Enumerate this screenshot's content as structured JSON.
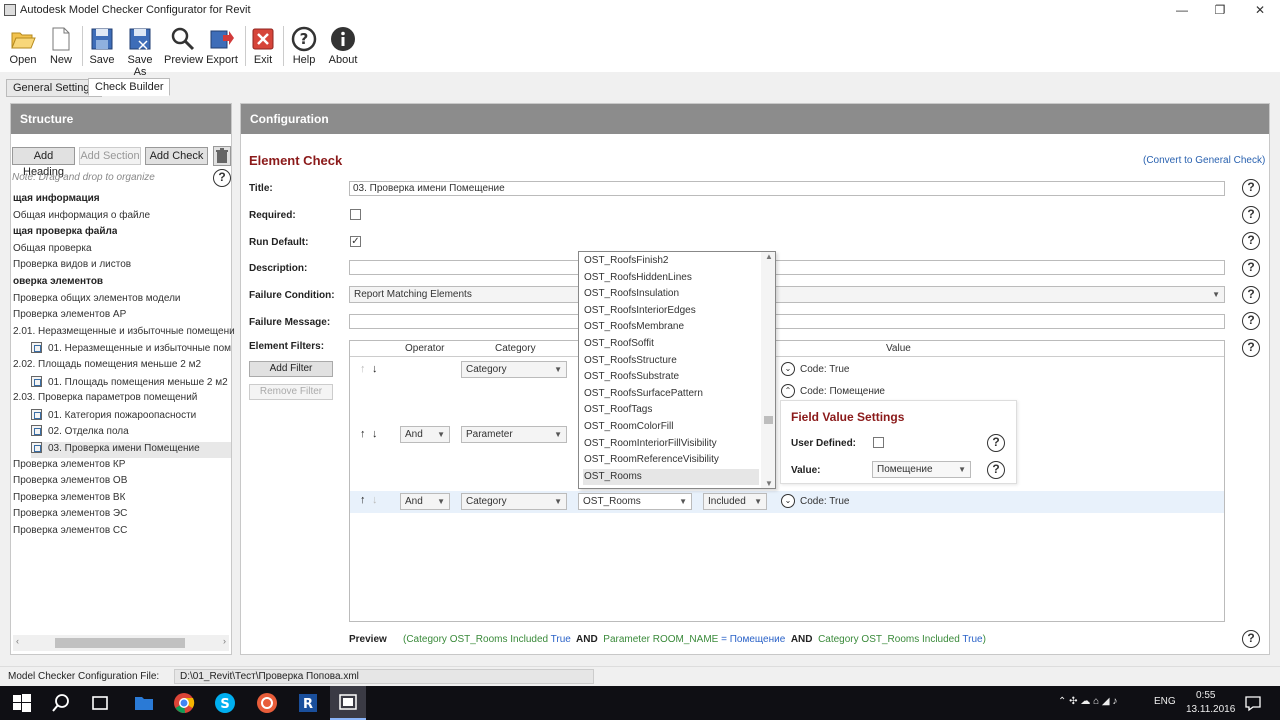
{
  "window": {
    "title": "Autodesk Model Checker Configurator for Revit",
    "minimize": "—",
    "maximize": "❐",
    "close": "✕"
  },
  "toolbar": {
    "open": "Open",
    "new": "New",
    "save": "Save",
    "save_as": "Save As",
    "preview": "Preview",
    "export": "Export",
    "exit": "Exit",
    "help": "Help",
    "about": "About"
  },
  "tabs": [
    "General Settings",
    "Check Builder"
  ],
  "structure": {
    "header": "Structure",
    "add_heading": "Add Heading",
    "add_section": "Add Section",
    "add_check": "Add Check",
    "note": "Note: Drag and drop to organize",
    "items": [
      {
        "label": "щая информация",
        "bold": true,
        "child": false
      },
      {
        "label": "Общая информация о файле",
        "bold": false,
        "child": false
      },
      {
        "label": "щая проверка файла",
        "bold": true,
        "child": false
      },
      {
        "label": "Общая проверка",
        "bold": false,
        "child": false
      },
      {
        "label": "Проверка видов и листов",
        "bold": false,
        "child": false
      },
      {
        "label": "оверка элементов",
        "bold": true,
        "child": false
      },
      {
        "label": "Проверка общих элементов модели",
        "bold": false,
        "child": false
      },
      {
        "label": "Проверка элементов АР",
        "bold": false,
        "child": false
      },
      {
        "label": "2.01. Неразмещенные и избыточные помещени",
        "bold": false,
        "child": false
      },
      {
        "label": "01. Неразмещенные и избыточные пом",
        "bold": false,
        "child": true
      },
      {
        "label": "2.02. Площадь помещения меньше 2 м2",
        "bold": false,
        "child": false
      },
      {
        "label": "01. Площадь помещения меньше 2 м2",
        "bold": false,
        "child": true
      },
      {
        "label": "2.03. Проверка параметров помещений",
        "bold": false,
        "child": false
      },
      {
        "label": "01. Категория пожароопасности",
        "bold": false,
        "child": true
      },
      {
        "label": "02. Отделка пола",
        "bold": false,
        "child": true
      },
      {
        "label": "03. Проверка имени Помещение",
        "bold": false,
        "child": true,
        "selected": true
      },
      {
        "label": "Проверка элементов КР",
        "bold": false,
        "child": false
      },
      {
        "label": "Проверка элементов ОВ",
        "bold": false,
        "child": false
      },
      {
        "label": "Проверка элементов ВК",
        "bold": false,
        "child": false
      },
      {
        "label": "Проверка элементов ЭС",
        "bold": false,
        "child": false
      },
      {
        "label": "Проверка элементов СС",
        "bold": false,
        "child": false
      }
    ]
  },
  "config": {
    "header": "Configuration",
    "title": "Element Check",
    "convert_link": "(Convert to General Check)",
    "labels": {
      "title": "Title:",
      "required": "Required:",
      "run_default": "Run Default:",
      "description": "Description:",
      "failure_condition": "Failure Condition:",
      "failure_message": "Failure Message:",
      "element_filters": "Element Filters:"
    },
    "title_value": "03. Проверка имени Помещение",
    "run_default_check": "✓",
    "failure_condition_value": "Report Matching Elements",
    "add_filter": "Add Filter",
    "remove_filter": "Remove Filter",
    "columns": [
      "Operator",
      "Category",
      "Value"
    ],
    "rows": [
      {
        "operator": "",
        "category": "Category",
        "code": "Code: True"
      },
      {
        "operator": "And",
        "category": "Parameter",
        "code": "Code: Помещение"
      },
      {
        "operator": "And",
        "category": "Category",
        "value_select": "OST_Rooms",
        "included": "Included",
        "code": "Code: True"
      }
    ],
    "dropdown": [
      "OST_RoofsFinish2",
      "OST_RoofsHiddenLines",
      "OST_RoofsInsulation",
      "OST_RoofsInteriorEdges",
      "OST_RoofsMembrane",
      "OST_RoofSoffit",
      "OST_RoofsStructure",
      "OST_RoofsSubstrate",
      "OST_RoofsSurfacePattern",
      "OST_RoofTags",
      "OST_RoomColorFill",
      "OST_RoomInteriorFillVisibility",
      "OST_RoomReferenceVisibility",
      "OST_Rooms"
    ],
    "fvs": {
      "title": "Field Value Settings",
      "user_defined": "User Defined:",
      "value_label": "Value:",
      "value": "Помещение"
    },
    "preview_label": "Preview",
    "preview_parts": [
      {
        "t": "(Category ",
        "c": "c-green"
      },
      {
        "t": "OST_Rooms",
        "c": "c-green"
      },
      {
        "t": " Included ",
        "c": "c-green"
      },
      {
        "t": "True",
        "c": "c-blue"
      },
      {
        "t": "  AND  ",
        "c": "c-dark"
      },
      {
        "t": "Parameter ",
        "c": "c-green"
      },
      {
        "t": "ROOM_NAME",
        "c": "c-green"
      },
      {
        "t": " = ",
        "c": "c-blue"
      },
      {
        "t": "Помещение",
        "c": "c-blue"
      },
      {
        "t": "  AND  ",
        "c": "c-dark"
      },
      {
        "t": "Category ",
        "c": "c-green"
      },
      {
        "t": "OST_Rooms",
        "c": "c-green"
      },
      {
        "t": " Included ",
        "c": "c-green"
      },
      {
        "t": "True",
        "c": "c-blue"
      },
      {
        "t": ")",
        "c": "c-green"
      }
    ]
  },
  "status": {
    "label": "Model Checker Configuration File:",
    "path": "D:\\01_Revit\\Тест\\Проверка Попова.xml"
  },
  "taskbar": {
    "lang": "ENG",
    "time": "0:55",
    "date": "13.11.2016"
  }
}
